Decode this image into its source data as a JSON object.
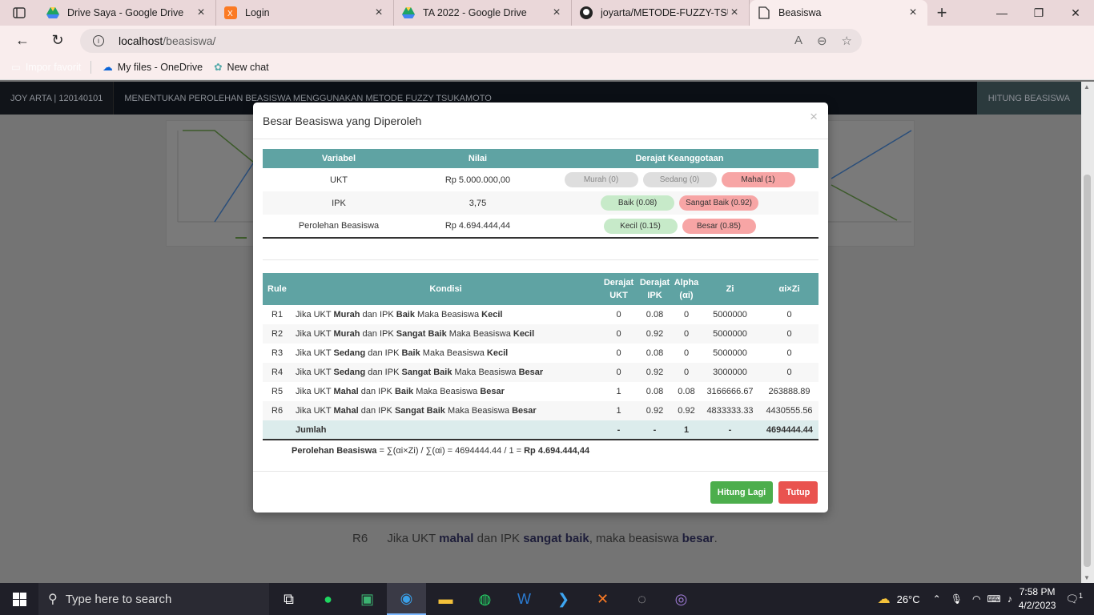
{
  "browser": {
    "tabs": [
      {
        "title": "Drive Saya - Google Drive",
        "icon": "google-drive-icon"
      },
      {
        "title": "Login",
        "icon": "xampp-icon"
      },
      {
        "title": "TA 2022 - Google Drive",
        "icon": "google-drive-icon"
      },
      {
        "title": "joyarta/METODE-FUZZY-TSUKAMOTO",
        "icon": "github-icon"
      },
      {
        "title": "Beasiswa",
        "icon": "page-icon",
        "active": true
      }
    ],
    "url_host": "localhost",
    "url_path": "/beasiswa/",
    "favorites": [
      {
        "label": "Impor favorit"
      },
      {
        "label": "My files - OneDrive"
      },
      {
        "label": "New chat"
      }
    ]
  },
  "page": {
    "brand": "JOY ARTA | 120140101",
    "nav_title": "MENENTUKAN PEROLEHAN BEASISWA MENGGUNAKAN METODE FUZZY TSUKAMOTO",
    "nav_right": "HITUNG BEASISWA",
    "bg_rule": {
      "id": "R6",
      "p1": "Jika UKT ",
      "b1": "mahal",
      "p2": " dan IPK ",
      "b2": "sangat baik",
      "p3": ", maka beasiswa ",
      "b3": "besar",
      "p4": "."
    }
  },
  "modal": {
    "title": "Besar Beasiswa yang Diperoleh",
    "close": "×",
    "table1": {
      "headers": [
        "Variabel",
        "Nilai",
        "Derajat Keanggotaan"
      ],
      "rows": [
        {
          "var": "UKT",
          "val": "Rp 5.000.000,00",
          "pills": [
            "Murah (0)",
            "Sedang (0)",
            "Mahal (1)"
          ]
        },
        {
          "var": "IPK",
          "val": "3,75",
          "pills": [
            "Baik (0.08)",
            "Sangat Baik (0.92)"
          ]
        },
        {
          "var": "Perolehan Beasiswa",
          "val": "Rp 4.694.444,44",
          "pills": [
            "Kecil (0.15)",
            "Besar (0.85)"
          ]
        }
      ]
    },
    "table2": {
      "headers": [
        "Rule",
        "Kondisi",
        "Derajat UKT",
        "Derajat IPK",
        "Alpha (αi)",
        "Zi",
        "αi×Zi"
      ],
      "rows": [
        {
          "rule": "R1",
          "k": [
            "Jika UKT ",
            "Murah",
            " dan IPK ",
            "Baik",
            " Maka Beasiswa ",
            "Kecil"
          ],
          "ukt": "0",
          "ipk": "0.08",
          "alpha": "0",
          "zi": "5000000",
          "az": "0"
        },
        {
          "rule": "R2",
          "k": [
            "Jika UKT ",
            "Murah",
            " dan IPK ",
            "Sangat Baik",
            " Maka Beasiswa ",
            "Kecil"
          ],
          "ukt": "0",
          "ipk": "0.92",
          "alpha": "0",
          "zi": "5000000",
          "az": "0"
        },
        {
          "rule": "R3",
          "k": [
            "Jika UKT ",
            "Sedang",
            " dan IPK ",
            "Baik",
            " Maka Beasiswa ",
            "Kecil"
          ],
          "ukt": "0",
          "ipk": "0.08",
          "alpha": "0",
          "zi": "5000000",
          "az": "0"
        },
        {
          "rule": "R4",
          "k": [
            "Jika UKT ",
            "Sedang",
            " dan IPK ",
            "Sangat Baik",
            " Maka Beasiswa ",
            "Besar"
          ],
          "ukt": "0",
          "ipk": "0.92",
          "alpha": "0",
          "zi": "3000000",
          "az": "0"
        },
        {
          "rule": "R5",
          "k": [
            "Jika UKT ",
            "Mahal",
            " dan IPK ",
            "Baik",
            " Maka Beasiswa ",
            "Besar"
          ],
          "ukt": "1",
          "ipk": "0.08",
          "alpha": "0.08",
          "zi": "3166666.67",
          "az": "263888.89"
        },
        {
          "rule": "R6",
          "k": [
            "Jika UKT ",
            "Mahal",
            " dan IPK ",
            "Sangat Baik",
            " Maka Beasiswa ",
            "Besar"
          ],
          "ukt": "1",
          "ipk": "0.92",
          "alpha": "0.92",
          "zi": "4833333.33",
          "az": "4430555.56"
        }
      ],
      "sum": {
        "label": "Jumlah",
        "ukt": "-",
        "ipk": "-",
        "alpha": "1",
        "zi": "-",
        "az": "4694444.44"
      }
    },
    "formula_label": "Perolehan Beasiswa",
    "formula_mid": " = ∑(αi×Zi) / ∑(αi) = 4694444.44 / 1 = ",
    "formula_result": "Rp 4.694.444,44",
    "btn_recalc": "Hitung Lagi",
    "btn_close": "Tutup"
  },
  "taskbar": {
    "search_placeholder": "Type here to search",
    "weather": "26°C",
    "time": "7:58 PM",
    "date": "4/2/2023",
    "notif_count": "1"
  }
}
